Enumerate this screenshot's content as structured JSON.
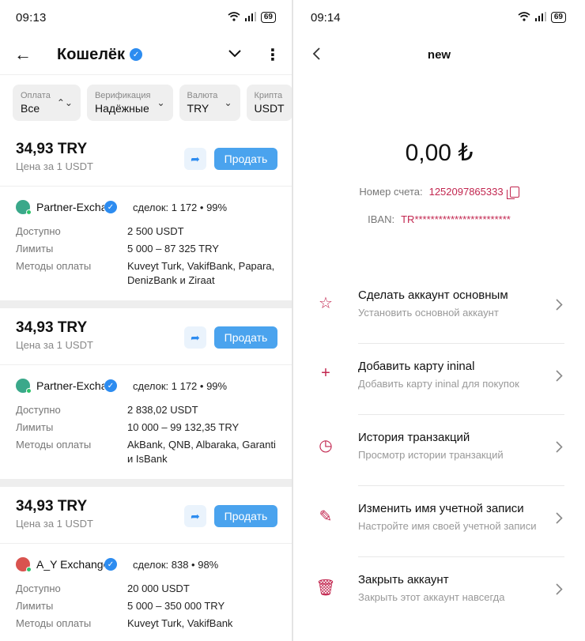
{
  "left": {
    "status": {
      "time": "09:13",
      "battery": "69"
    },
    "appbar": {
      "title": "Кошелёк"
    },
    "filters": [
      {
        "label": "Оплата",
        "value": "Все",
        "icon": "⌃⌄"
      },
      {
        "label": "Верификация",
        "value": "Надёжные",
        "icon": "⌄"
      },
      {
        "label": "Валюта",
        "value": "TRY",
        "icon": "⌄"
      },
      {
        "label": "Крипта",
        "value": "USDT",
        "icon": ""
      }
    ],
    "offers": [
      {
        "price": "34,93 TRY",
        "sub": "Цена за 1 USDT",
        "sell": "Продать",
        "trader": "Partner-Exchange",
        "avatar_color": "#3aa88a",
        "deals": "сделок: 1 172 • 99%",
        "rows": [
          {
            "k": "Доступно",
            "v": "2 500 USDT"
          },
          {
            "k": "Лимиты",
            "v": "5 000 – 87 325 TRY"
          },
          {
            "k": "Методы оплаты",
            "v": "Kuveyt Turk, VakifBank, Papara, DenizBank и Ziraat"
          }
        ]
      },
      {
        "price": "34,93 TRY",
        "sub": "Цена за 1 USDT",
        "sell": "Продать",
        "trader": "Partner-Exchange",
        "avatar_color": "#3aa88a",
        "deals": "сделок: 1 172 • 99%",
        "rows": [
          {
            "k": "Доступно",
            "v": "2 838,02 USDT"
          },
          {
            "k": "Лимиты",
            "v": "10 000 – 99 132,35 TRY"
          },
          {
            "k": "Методы оплаты",
            "v": "AkBank, QNB, Albaraka, Garanti и IsBank"
          }
        ]
      },
      {
        "price": "34,93 TRY",
        "sub": "Цена за 1 USDT",
        "sell": "Продать",
        "trader": "A_Y Exchange",
        "avatar_color": "#d9534f",
        "deals": "сделок: 838 • 98%",
        "rows": [
          {
            "k": "Доступно",
            "v": "20 000 USDT"
          },
          {
            "k": "Лимиты",
            "v": "5 000 – 350 000 TRY"
          },
          {
            "k": "Методы оплаты",
            "v": "Kuveyt Turk, VakifBank"
          }
        ]
      }
    ]
  },
  "right": {
    "status": {
      "time": "09:14",
      "battery": "69"
    },
    "header": {
      "title": "new"
    },
    "balance": "0,00 ₺",
    "account": {
      "label": "Номер счета:",
      "value": "1252097865333"
    },
    "iban": {
      "label": "IBAN:",
      "value": "TR************************"
    },
    "menu": [
      {
        "icon": "star-icon",
        "glyph": "☆",
        "title": "Сделать аккаунт основным",
        "sub": "Установить основной аккаунт"
      },
      {
        "icon": "plus-icon",
        "glyph": "+",
        "title": "Добавить карту ininal",
        "sub": "Добавить карту ininal для покупок"
      },
      {
        "icon": "history-icon",
        "glyph": "◷",
        "title": "История транзакций",
        "sub": "Просмотр истории транзакций"
      },
      {
        "icon": "pencil-icon",
        "glyph": "✎",
        "title": "Изменить имя учетной записи",
        "sub": "Настройте имя своей учетной записи"
      },
      {
        "icon": "trash-icon",
        "glyph": "🗑",
        "title": "Закрыть аккаунт",
        "sub": "Закрыть этот аккаунт навсегда"
      }
    ]
  },
  "colors": {
    "accent_blue": "#4aa3ee",
    "accent_red": "#c2264f",
    "verified": "#2d8cf0"
  }
}
